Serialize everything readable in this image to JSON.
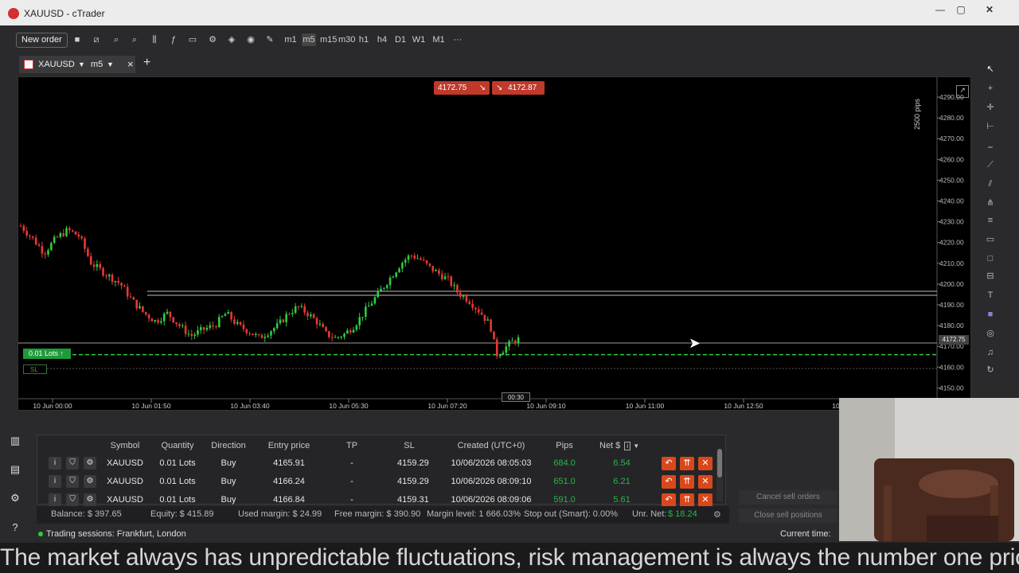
{
  "window": {
    "title": "XAUUSD - cTrader"
  },
  "toolbar": {
    "new_order_label": "New order",
    "timeframes": [
      "m1",
      "m5",
      "m15",
      "m30",
      "h1",
      "h4",
      "D1",
      "W1",
      "M1"
    ],
    "more": "···"
  },
  "tab": {
    "symbol": "XAUUSD",
    "timeframe": "m5",
    "close": "×",
    "add": "+"
  },
  "chart": {
    "sell_price": "4172.75",
    "buy_price": "4172.87",
    "scale_label": "2500 pips",
    "current_price_label": "4172.75",
    "lots_label": "0.01 Lots ↑",
    "sl_label": "SL",
    "countdown": "00:30",
    "y_ticks": [
      "4290.00",
      "4280.00",
      "4270.00",
      "4260.00",
      "4250.00",
      "4240.00",
      "4230.00",
      "4220.00",
      "4210.00",
      "4200.00",
      "4190.00",
      "4180.00",
      "4170.00",
      "4160.00",
      "4150.00"
    ],
    "x_ticks": [
      "10 Jun 00:00",
      "10 Jun 01:50",
      "10 Jun 03:40",
      "10 Jun 05:30",
      "10 Jun 07:20",
      "10 Jun 09:10",
      "10 Jun 11:00",
      "10 Jun 12:50",
      "10 Jun"
    ],
    "colors": {
      "up": "#2ecc40",
      "down": "#e53935",
      "entry_line": "#2ecc40"
    }
  },
  "positions": {
    "headers": [
      "Symbol",
      "Quantity",
      "Direction",
      "Entry price",
      "TP",
      "SL",
      "Created (UTC+0)",
      "Pips",
      "Net $"
    ],
    "rows": [
      {
        "symbol": "XAUUSD",
        "quantity": "0.01 Lots",
        "direction": "Buy",
        "entry": "4165.91",
        "tp": "-",
        "sl": "4159.29",
        "created": "10/06/2026 08:05:03",
        "pips": "684.0",
        "net": "6.54"
      },
      {
        "symbol": "XAUUSD",
        "quantity": "0.01 Lots",
        "direction": "Buy",
        "entry": "4166.24",
        "tp": "-",
        "sl": "4159.29",
        "created": "10/06/2026 08:09:10",
        "pips": "651.0",
        "net": "6.21"
      },
      {
        "symbol": "XAUUSD",
        "quantity": "0.01 Lots",
        "direction": "Buy",
        "entry": "4166.84",
        "tp": "-",
        "sl": "4159.31",
        "created": "10/06/2026 08:09:06",
        "pips": "591.0",
        "net": "5.61"
      }
    ]
  },
  "side_actions": {
    "cancel_sell": "Cancel sell orders",
    "close_sell": "Close sell positions"
  },
  "status": {
    "balance": "Balance: $ 397.65",
    "equity": "Equity: $ 415.89",
    "used_margin": "Used margin: $ 24.99",
    "free_margin": "Free margin: $ 390.90",
    "margin_level": "Margin level: 1 666.03%",
    "stop_out": "Stop out (Smart): 0.00%",
    "unr_net_label": "Unr. Net:",
    "unr_net_value": "$ 18.24"
  },
  "sessions": {
    "text": "Trading sessions: Frankfurt, London",
    "current_time_label": "Current time:"
  },
  "caption": "The market always has unpredictable fluctuations, risk management is always the number one priority"
}
